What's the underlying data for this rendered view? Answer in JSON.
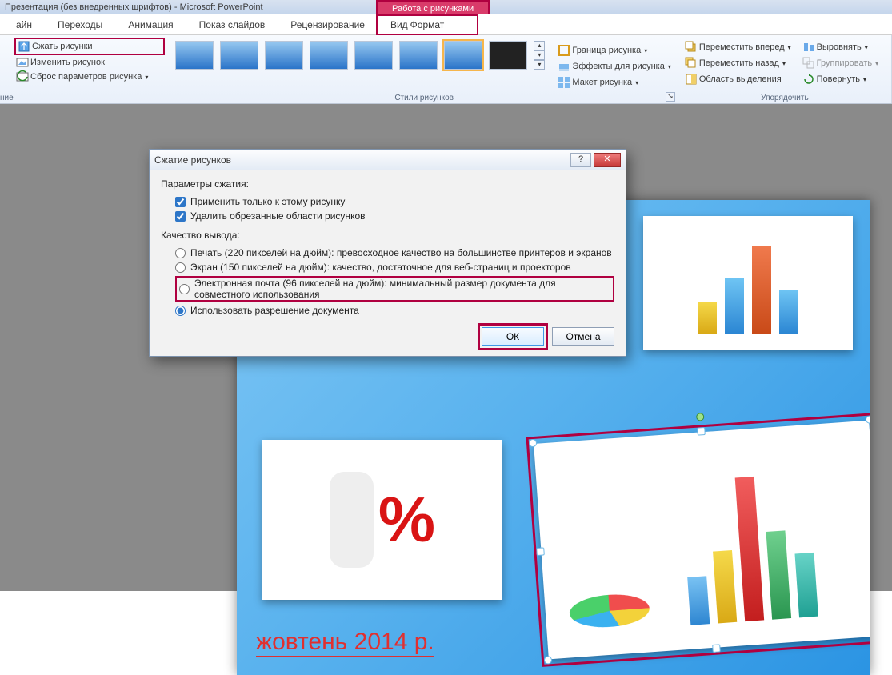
{
  "window": {
    "title_prefix": "Презентация (без внедренных шрифтов)  -  Microsoft PowerPoint",
    "contextual_title": "Работа с рисунками"
  },
  "tabs": {
    "items": [
      "айн",
      "Переходы",
      "Анимация",
      "Показ слайдов",
      "Рецензирование",
      "Вид",
      "Формат"
    ],
    "active_index": 6
  },
  "ribbon": {
    "adjust": {
      "compress": "Сжать рисунки",
      "change": "Изменить рисунок",
      "reset": "Сброс параметров рисунка",
      "group_label_partial": "ние"
    },
    "styles": {
      "label": "Стили рисунков"
    },
    "picture_tools": {
      "border": "Граница рисунка",
      "effects": "Эффекты для рисунка",
      "layout": "Макет рисунка"
    },
    "arrange": {
      "label": "Упорядочить",
      "bring_forward": "Переместить вперед",
      "send_backward": "Переместить назад",
      "selection_pane": "Область выделения",
      "align": "Выровнять",
      "group": "Группировать",
      "rotate": "Повернуть"
    }
  },
  "slide": {
    "date_text": "жовтень 2014 р."
  },
  "dialog": {
    "title": "Сжатие рисунков",
    "section1": "Параметры сжатия:",
    "opt_apply_only": "Применить только к этому рисунку",
    "opt_delete_cropped": "Удалить обрезанные области рисунков",
    "section2": "Качество вывода:",
    "radio_print": "Печать (220 пикселей на дюйм): превосходное качество на большинстве принтеров и экранов",
    "radio_screen": "Экран (150 пикселей на дюйм): качество, достаточное для веб-страниц и проекторов",
    "radio_email": "Электронная почта (96 пикселей на дюйм): минимальный размер документа для совместного использования",
    "radio_docres": "Использовать разрешение документа",
    "ok": "ОК",
    "cancel": "Отмена",
    "help_glyph": "?",
    "close_glyph": "✕"
  }
}
